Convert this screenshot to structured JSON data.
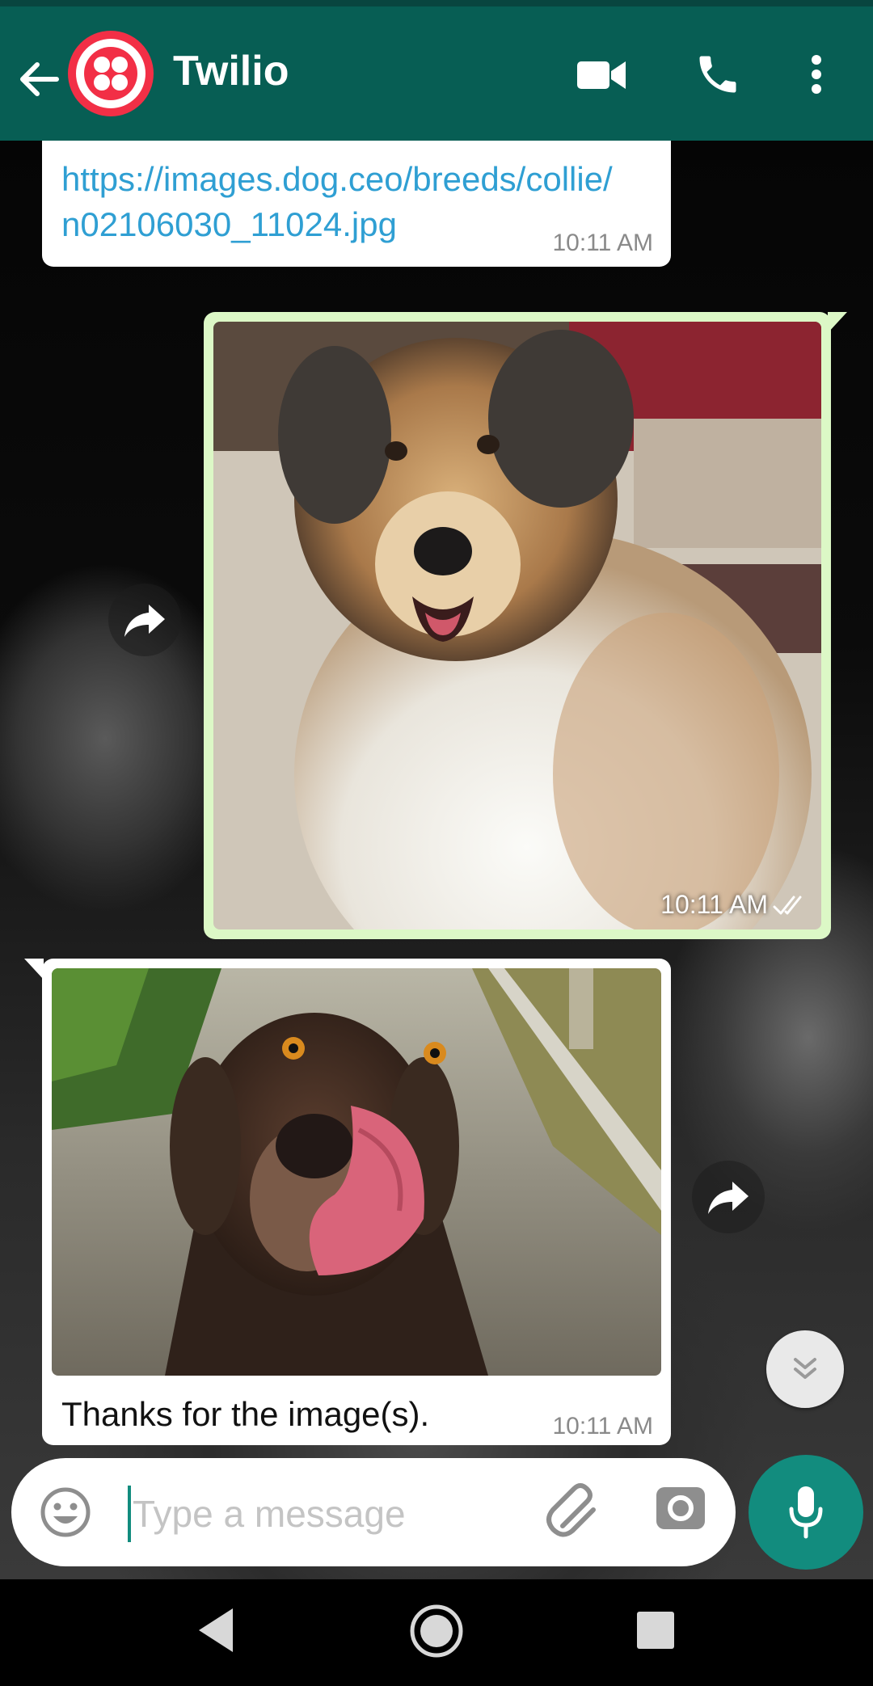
{
  "header": {
    "contact_name": "Twilio",
    "color": "#075e54"
  },
  "messages": [
    {
      "direction": "incoming",
      "type": "link",
      "text": "https://images.dog.ceo/breeds/collie/n02106030_11024.jpg",
      "time": "10:11 AM"
    },
    {
      "direction": "outgoing",
      "type": "image",
      "subject": "collie photo",
      "time": "10:11 AM",
      "status": "read"
    },
    {
      "direction": "incoming",
      "type": "image",
      "subject": "brown dog licking nose",
      "caption": "Thanks for the image(s).",
      "time": "10:11 AM"
    }
  ],
  "composer": {
    "placeholder": "Type a message",
    "value": ""
  },
  "icons": [
    "back-arrow-icon",
    "twilio-logo",
    "video-call-icon",
    "phone-icon",
    "more-vert-icon",
    "forward-icon",
    "chevron-double-down-icon",
    "emoji-icon",
    "attach-icon",
    "camera-icon",
    "mic-icon",
    "nav-back-icon",
    "nav-home-icon",
    "nav-recents-icon"
  ],
  "colors": {
    "accent": "#128c7e",
    "outgoing_bubble": "#dcf8c6",
    "link": "#2f9fd3",
    "brand_red": "#f22f46"
  }
}
